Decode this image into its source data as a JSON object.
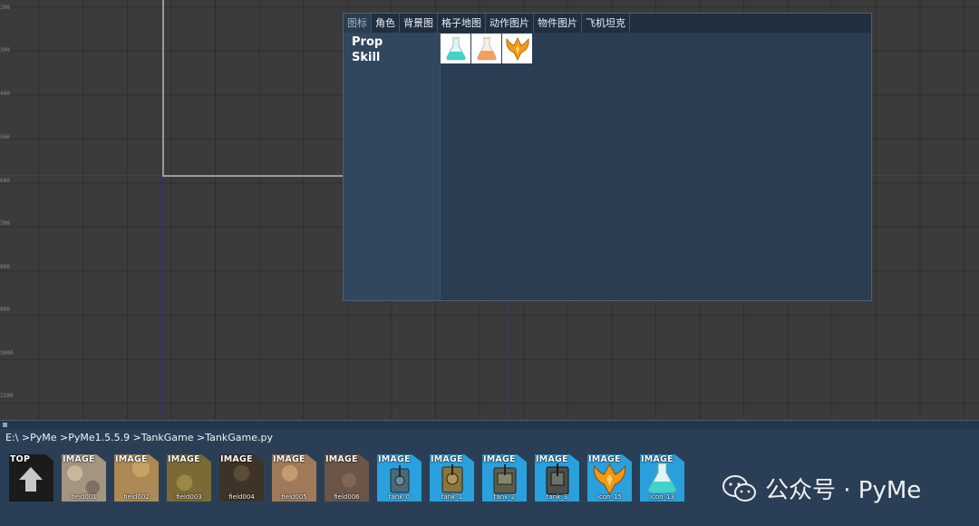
{
  "ruler": {
    "labels": [
      "200",
      "300",
      "400",
      "500",
      "600",
      "700",
      "800",
      "900",
      "1000",
      "1100"
    ]
  },
  "resource_panel": {
    "tabs": [
      {
        "label": "图标",
        "active": true
      },
      {
        "label": "角色"
      },
      {
        "label": "背景图"
      },
      {
        "label": "格子地图"
      },
      {
        "label": "动作图片"
      },
      {
        "label": "物件图片"
      },
      {
        "label": "飞机坦克"
      }
    ],
    "categories": [
      "Prop",
      "Skill"
    ],
    "thumbnails": [
      {
        "icon": "flask-cyan-icon",
        "color": "#41d3c9"
      },
      {
        "icon": "flask-orange-icon",
        "color": "#f0a060"
      },
      {
        "icon": "phoenix-emblem-icon",
        "color": "#f29a17"
      }
    ]
  },
  "browser": {
    "breadcrumb": "E:\\ >PyMe >PyMe1.5.5.9 >TankGame >TankGame.py",
    "files": [
      {
        "type": "TOP",
        "name": "",
        "icon": "up-arrow-icon"
      },
      {
        "type": "IMAGE",
        "name": "field001"
      },
      {
        "type": "IMAGE",
        "name": "field002"
      },
      {
        "type": "IMAGE",
        "name": "field003"
      },
      {
        "type": "IMAGE",
        "name": "field004"
      },
      {
        "type": "IMAGE",
        "name": "field005"
      },
      {
        "type": "IMAGE",
        "name": "field006"
      },
      {
        "type": "IMAGE",
        "name": "tank_0"
      },
      {
        "type": "IMAGE",
        "name": "tank_1"
      },
      {
        "type": "IMAGE",
        "name": "tank_2"
      },
      {
        "type": "IMAGE",
        "name": "tank_3"
      },
      {
        "type": "IMAGE",
        "name": "icon_15"
      },
      {
        "type": "IMAGE",
        "name": "icon_13"
      }
    ]
  },
  "watermark": {
    "text": "公众号 · PyMe",
    "icon": "wechat-icon"
  },
  "colors": {
    "panel_bg": "#2b3d51",
    "sidebar_bg": "#30475e",
    "bottom_bg": "#2a3f55",
    "tile_blue": "#2aa0dc"
  }
}
